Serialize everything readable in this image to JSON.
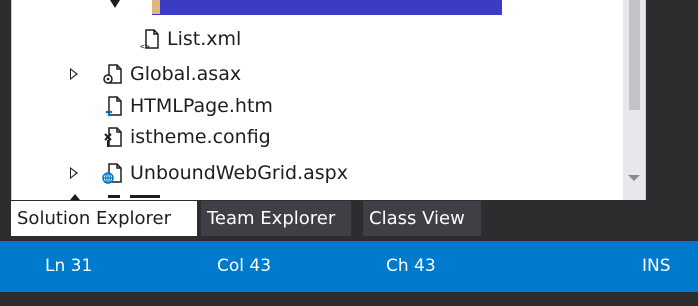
{
  "solution_explorer": {
    "items": [
      {
        "label": "List.xml",
        "icon": "xml-file-icon",
        "expandable": false
      },
      {
        "label": "Global.asax",
        "icon": "asax-file-icon",
        "expandable": true
      },
      {
        "label": "HTMLPage.htm",
        "icon": "html-file-icon",
        "expandable": false
      },
      {
        "label": "istheme.config",
        "icon": "config-file-icon",
        "expandable": false
      },
      {
        "label": "UnboundWebGrid.aspx",
        "icon": "aspx-file-icon",
        "expandable": true
      }
    ]
  },
  "tabs": [
    {
      "label": "Solution Explorer",
      "active": true
    },
    {
      "label": "Team Explorer",
      "active": false
    },
    {
      "label": "Class View",
      "active": false
    }
  ],
  "status_bar": {
    "line": "Ln 31",
    "column": "Col 43",
    "character": "Ch 43",
    "mode": "INS"
  },
  "colors": {
    "status_bar": "#007acc",
    "selection": "#3b3bc4",
    "chrome": "#2d2d30"
  }
}
